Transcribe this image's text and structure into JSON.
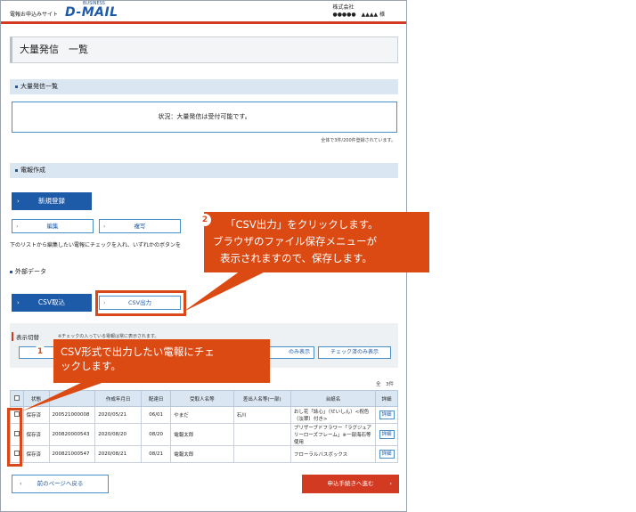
{
  "header": {
    "logo_small": "電報お申込みサイト",
    "logo_main": "D-MAIL",
    "logo_business": "BUSINESS",
    "company_line1": "株式会社",
    "company_line2": "●●●●●　▲▲▲▲ 様"
  },
  "page_title": "大量発信　一覧",
  "bulk_section": {
    "title": "大量発信一覧",
    "status": "状況：大量発信は受付可能です。",
    "count": "全体で3件/200件登録されています。"
  },
  "create_section": {
    "title": "電報作成",
    "new_button": "新規登録",
    "edit_button": "編集",
    "copy_button": "複写",
    "hint": "下のリストから編集したい電報にチェックを入れ、いずれかのボタンを"
  },
  "external_section": {
    "title": "外部データ",
    "import_button": "CSV取込",
    "export_button": "CSV出力"
  },
  "toggle": {
    "title": "表示切替",
    "note": "※チェックの入っている電報は常に表示されます。",
    "btn_checked_only": "のみ表示",
    "btn_checked_done": "チェック済のみ表示"
  },
  "table": {
    "total": "全　3件",
    "headers": [
      "",
      "状態",
      "",
      "作成年月日",
      "配達日",
      "受取人名等",
      "差出人名等(一部)",
      "台紙名",
      "詳細"
    ],
    "rows": [
      {
        "status": "保存済",
        "id": "200521000008",
        "date": "2020/05/21",
        "delivery": "06/01",
        "recipient": "やまだ",
        "sender": "石川",
        "mount": "おし花「詠心」（せいしん）<祝色（淡翠）付き>",
        "detail": "詳細"
      },
      {
        "status": "保存済",
        "id": "200820000543",
        "date": "2020/08/20",
        "delivery": "08/20",
        "recipient": "電報太郎",
        "sender": "",
        "mount": "プリザーブドフラワー「ラグジュアリーローズフレーム」※一部海石等使用",
        "detail": "詳細"
      },
      {
        "status": "保存済",
        "id": "200821000547",
        "date": "2020/08/21",
        "delivery": "08/21",
        "recipient": "電報太郎",
        "sender": "",
        "mount": "フローラルバスボックス",
        "detail": "詳細"
      }
    ]
  },
  "footer": {
    "back_button": "前のページへ戻る",
    "next_button": "申込手続きへ進む"
  },
  "callouts": {
    "c1_number": "1",
    "c1_text_line1": "CSV形式で出力したい電報にチェ",
    "c1_text_line2": "ックします。",
    "c2_number": "2",
    "c2_text_line1": "「CSV出力」をクリックします。",
    "c2_text_line2": "ブラウザのファイル保存メニューが",
    "c2_text_line3": "表示されますので、保存します。"
  },
  "colors": {
    "accent": "#1d5aa8",
    "brand_red": "#d23a22",
    "callout": "#dc4a14"
  }
}
